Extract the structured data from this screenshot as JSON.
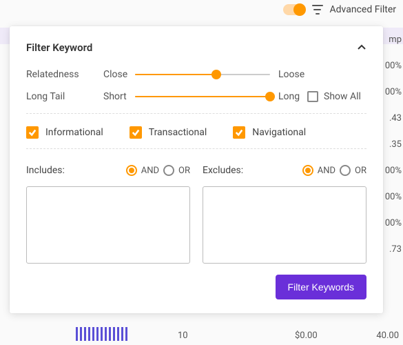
{
  "topbar": {
    "advanced_filter_label": "Advanced Filter"
  },
  "panel": {
    "title": "Filter Keyword",
    "relatedness": {
      "label": "Relatedness",
      "min_label": "Close",
      "max_label": "Loose",
      "percent": 60
    },
    "longtail": {
      "label": "Long Tail",
      "min_label": "Short",
      "max_label": "Long",
      "percent": 100,
      "show_all_label": "Show All"
    },
    "intents": {
      "informational": "Informational",
      "transactional": "Transactional",
      "navigational": "Navigational"
    },
    "includes": {
      "label": "Includes:",
      "and": "AND",
      "or": "OR"
    },
    "excludes": {
      "label": "Excludes:",
      "and": "AND",
      "or": "OR"
    },
    "button": "Filter Keywords"
  },
  "background": {
    "right_header": "mp",
    "right_values": [
      "00%",
      "00%",
      ".43",
      ".35",
      "00%",
      "00%",
      "00%",
      ".73"
    ],
    "axis_10": "10",
    "axis_price": "$0.00",
    "axis_40": "40.00"
  }
}
